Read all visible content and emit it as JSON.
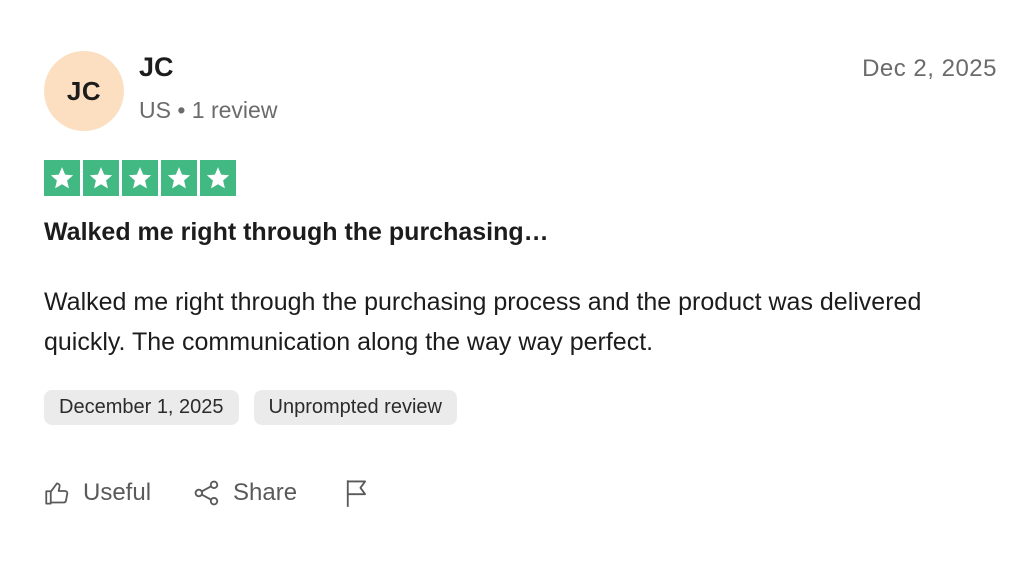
{
  "reviewer": {
    "initials": "JC",
    "name": "JC",
    "meta": "US • 1 review"
  },
  "review": {
    "date": "Dec 2, 2025",
    "rating": 5,
    "title": "Walked me right through the purchasing…",
    "body": "Walked me right through the purchasing process and the product was delivered quickly. The communication along the way way perfect."
  },
  "tags": {
    "experience_date": "December 1, 2025",
    "review_type": "Unprompted review"
  },
  "actions": {
    "useful_label": "Useful",
    "share_label": "Share",
    "flag_icon": "flag-icon"
  },
  "colors": {
    "star_bg": "#42b883",
    "avatar_bg": "#fbdfc0",
    "tag_bg": "#ebebeb"
  }
}
